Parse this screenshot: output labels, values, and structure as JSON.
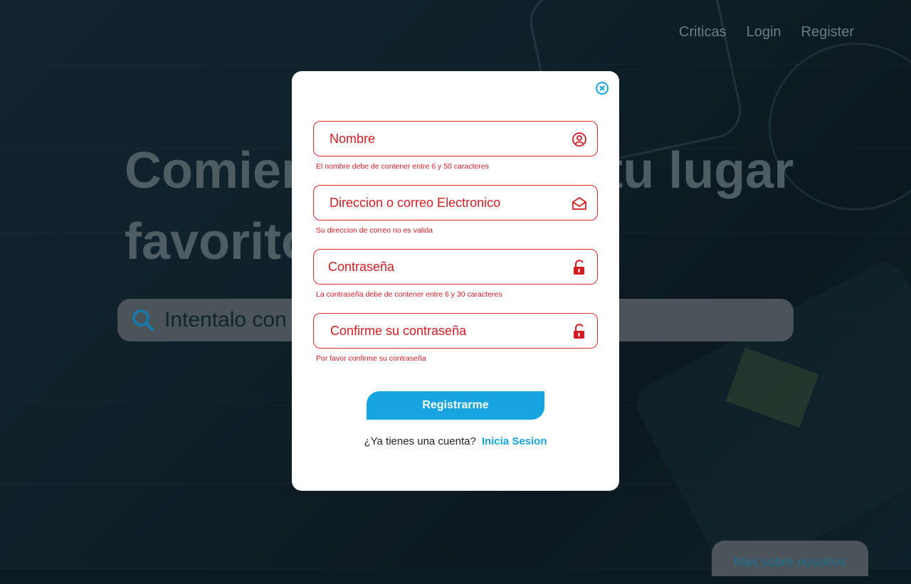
{
  "nav": {
    "items": [
      "Criticas",
      "Login",
      "Register"
    ]
  },
  "hero": {
    "title": "Comienza a buscar tu lugar favorito",
    "search_placeholder": "Intentalo con \""
  },
  "about_button": "Mas sobre nosotros",
  "modal": {
    "fields": [
      {
        "placeholder": "Nombre",
        "icon": "user-icon",
        "error": "El nombre debe de contener entre 6 y 50 caracteres"
      },
      {
        "placeholder": "Direccion o correo Electronico",
        "icon": "envelope-icon",
        "error": "Su direccion de correo no es valida"
      },
      {
        "placeholder": "Contraseña",
        "icon": "unlock-icon",
        "error": "La contraseña debe de contener entre 6 y 30 caracteres"
      },
      {
        "placeholder": "Confirme su contraseña",
        "icon": "unlock-icon",
        "error": "Por favor confirme su contraseña"
      }
    ],
    "submit_label": "Registrarme",
    "login_prompt": "¿Ya tienes una cuenta?",
    "login_link": "Inicia Sesion"
  },
  "colors": {
    "accent": "#17a4e0",
    "error": "#e0262a",
    "background": "#0f2029"
  }
}
